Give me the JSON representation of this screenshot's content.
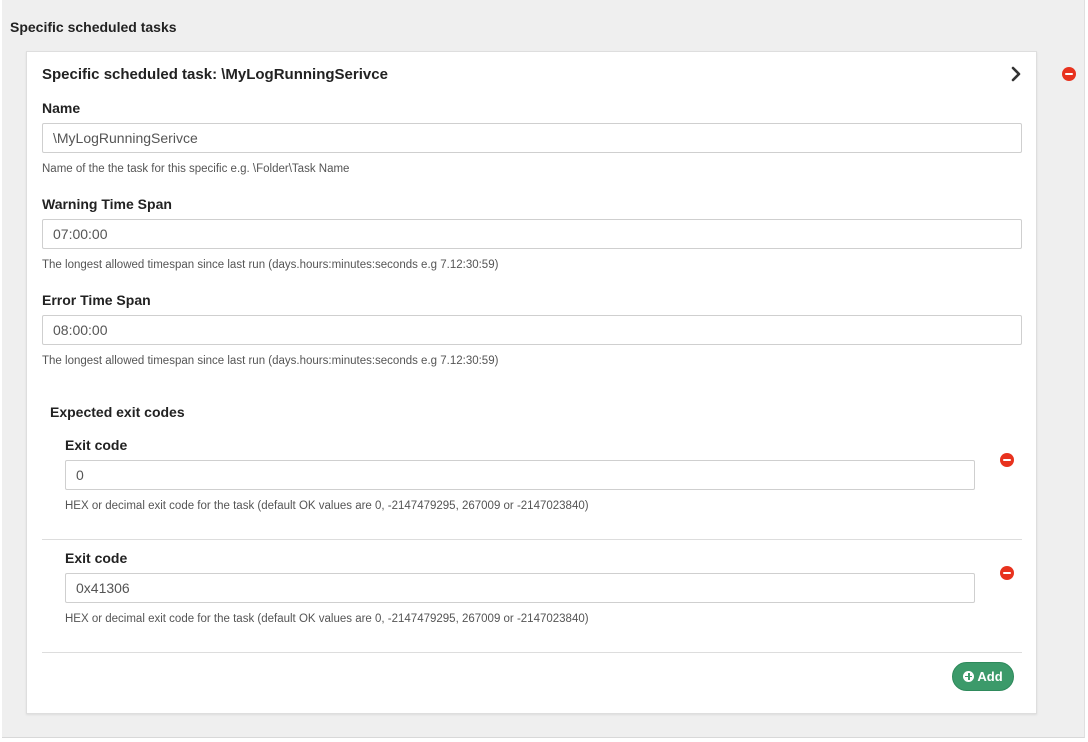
{
  "section": {
    "title": "Specific scheduled tasks"
  },
  "task": {
    "title": "Specific scheduled task: \\MyLogRunningSerivce",
    "fields": {
      "name": {
        "label": "Name",
        "value": "\\MyLogRunningSerivce",
        "help": "Name of the the task for this specific e.g. \\Folder\\Task Name"
      },
      "warning": {
        "label": "Warning Time Span",
        "value": "07:00:00",
        "help": "The longest allowed timespan since last run (days.hours:minutes:seconds e.g 7.12:30:59)"
      },
      "error": {
        "label": "Error Time Span",
        "value": "08:00:00",
        "help": "The longest allowed timespan since last run (days.hours:minutes:seconds e.g 7.12:30:59)"
      }
    },
    "exit_codes": {
      "title": "Expected exit codes",
      "items": [
        {
          "label": "Exit code",
          "value": "0",
          "help": "HEX or decimal exit code for the task (default OK values are 0, -2147479295, 267009 or -2147023840)"
        },
        {
          "label": "Exit code",
          "value": "0x41306",
          "help": "HEX or decimal exit code for the task (default OK values are 0, -2147479295, 267009 or -2147023840)"
        }
      ],
      "add_label": "Add"
    }
  },
  "icons": {
    "remove": "minus-circle-icon",
    "expand": "chevron-right-icon",
    "add": "plus-circle-icon"
  },
  "colors": {
    "remove": "#e8321e",
    "add_button": "#3c9a6a",
    "section_bg": "#efefef"
  }
}
